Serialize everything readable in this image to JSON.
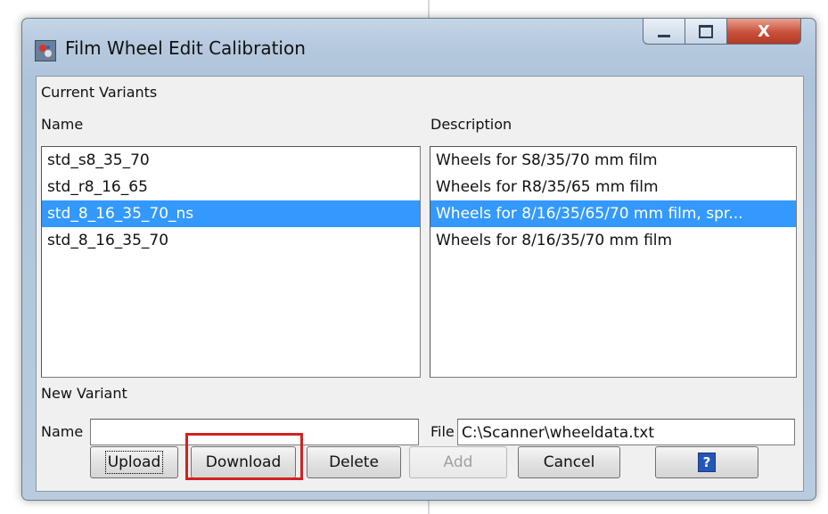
{
  "window": {
    "title": "Film Wheel Edit Calibration",
    "close_symbol": "X"
  },
  "current_variants": {
    "heading": "Current Variants",
    "name_header": "Name",
    "description_header": "Description",
    "selected_index": 2,
    "names": [
      "std_s8_35_70",
      "std_r8_16_65",
      "std_8_16_35_70_ns",
      "std_8_16_35_70"
    ],
    "descriptions": [
      "Wheels for S8/35/70 mm film",
      "Wheels for R8/35/65 mm film",
      "Wheels for 8/16/35/65/70 mm film, spr...",
      "Wheels for 8/16/35/70 mm film"
    ]
  },
  "new_variant": {
    "heading": "New Variant",
    "name_label": "Name",
    "name_value": "",
    "file_label": "File",
    "file_value": "C:\\Scanner\\wheeldata.txt"
  },
  "buttons": {
    "upload": "Upload",
    "download": "Download",
    "delete": "Delete",
    "add": "Add",
    "cancel": "Cancel",
    "help": "?"
  },
  "colors": {
    "selection": "#3399ff",
    "highlight_box": "#d42020"
  },
  "icons": [
    "app-icon",
    "minimize-icon",
    "maximize-icon",
    "close-icon",
    "help-icon"
  ]
}
